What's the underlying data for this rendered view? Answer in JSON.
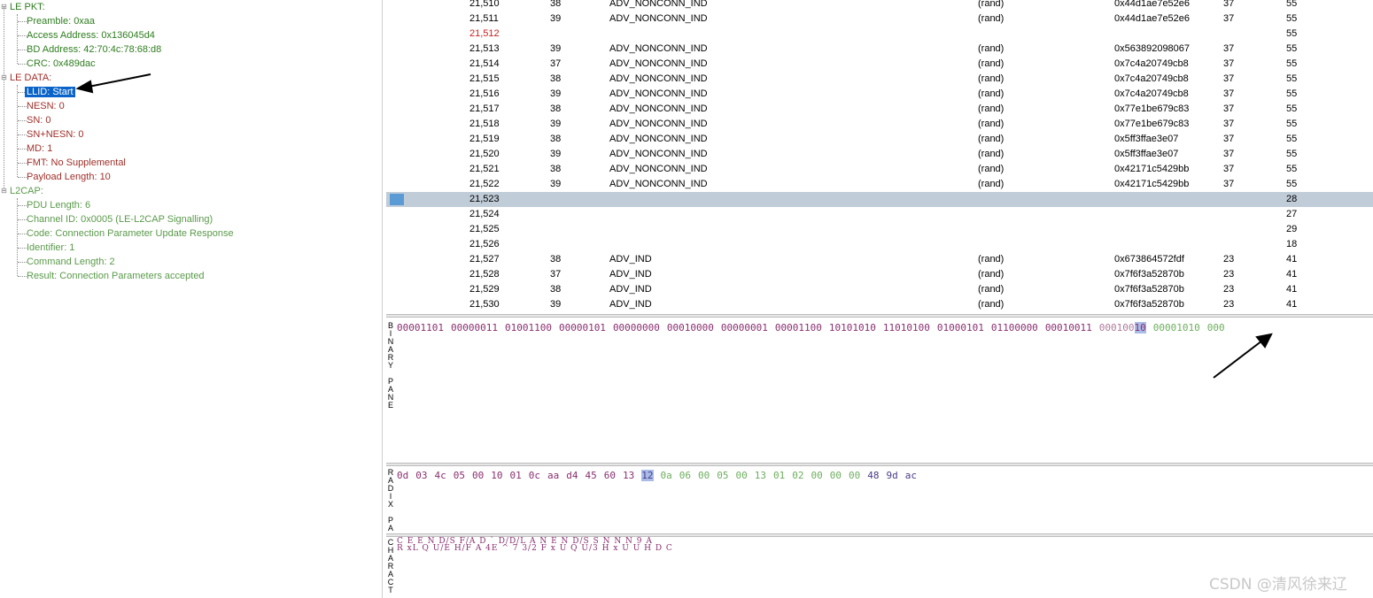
{
  "tree": {
    "le_pkt": {
      "label": "LE PKT:",
      "children": [
        "Preamble: 0xaa",
        "Access Address: 0x136045d4",
        "BD Address: 42:70:4c:78:68:d8",
        "CRC: 0x489dac"
      ]
    },
    "le_data": {
      "label": "LE DATA:",
      "selected": "LLID: Start",
      "children": [
        "NESN: 0",
        "SN: 0",
        "SN+NESN: 0",
        "MD: 1",
        "FMT: No Supplemental",
        "Payload Length: 10"
      ]
    },
    "l2cap": {
      "label": "L2CAP:",
      "children": [
        "PDU Length: 6",
        "Channel ID: 0x0005  (LE-L2CAP Signalling)",
        "Code: Connection Parameter Update Response",
        "Identifier: 1",
        "Command Length: 2",
        "Result: Connection Parameters accepted"
      ]
    },
    "expander_glyph": "⊟"
  },
  "packets": [
    {
      "num": "21,510",
      "ch": "38",
      "type": "ADV_NONCONN_IND",
      "rand": "(rand)",
      "addr": "0x44d1ae7e52e6",
      "len": "37",
      "pl": "55"
    },
    {
      "num": "21,511",
      "ch": "39",
      "type": "ADV_NONCONN_IND",
      "rand": "(rand)",
      "addr": "0x44d1ae7e52e6",
      "len": "37",
      "pl": "55"
    },
    {
      "num": "21,512",
      "ch": "",
      "type": "",
      "rand": "",
      "addr": "",
      "len": "",
      "pl": "55"
    },
    {
      "num": "21,513",
      "ch": "39",
      "type": "ADV_NONCONN_IND",
      "rand": "(rand)",
      "addr": "0x563892098067",
      "len": "37",
      "pl": "55"
    },
    {
      "num": "21,514",
      "ch": "37",
      "type": "ADV_NONCONN_IND",
      "rand": "(rand)",
      "addr": "0x7c4a20749cb8",
      "len": "37",
      "pl": "55"
    },
    {
      "num": "21,515",
      "ch": "38",
      "type": "ADV_NONCONN_IND",
      "rand": "(rand)",
      "addr": "0x7c4a20749cb8",
      "len": "37",
      "pl": "55"
    },
    {
      "num": "21,516",
      "ch": "39",
      "type": "ADV_NONCONN_IND",
      "rand": "(rand)",
      "addr": "0x7c4a20749cb8",
      "len": "37",
      "pl": "55"
    },
    {
      "num": "21,517",
      "ch": "38",
      "type": "ADV_NONCONN_IND",
      "rand": "(rand)",
      "addr": "0x77e1be679c83",
      "len": "37",
      "pl": "55"
    },
    {
      "num": "21,518",
      "ch": "39",
      "type": "ADV_NONCONN_IND",
      "rand": "(rand)",
      "addr": "0x77e1be679c83",
      "len": "37",
      "pl": "55"
    },
    {
      "num": "21,519",
      "ch": "38",
      "type": "ADV_NONCONN_IND",
      "rand": "(rand)",
      "addr": "0x5ff3ffae3e07",
      "len": "37",
      "pl": "55"
    },
    {
      "num": "21,520",
      "ch": "39",
      "type": "ADV_NONCONN_IND",
      "rand": "(rand)",
      "addr": "0x5ff3ffae3e07",
      "len": "37",
      "pl": "55"
    },
    {
      "num": "21,521",
      "ch": "38",
      "type": "ADV_NONCONN_IND",
      "rand": "(rand)",
      "addr": "0x42171c5429bb",
      "len": "37",
      "pl": "55"
    },
    {
      "num": "21,522",
      "ch": "39",
      "type": "ADV_NONCONN_IND",
      "rand": "(rand)",
      "addr": "0x42171c5429bb",
      "len": "37",
      "pl": "55"
    },
    {
      "num": "21,523",
      "ch": "",
      "type": "",
      "rand": "",
      "addr": "",
      "len": "",
      "pl": "28"
    },
    {
      "num": "21,524",
      "ch": "",
      "type": "",
      "rand": "",
      "addr": "",
      "len": "",
      "pl": "27"
    },
    {
      "num": "21,525",
      "ch": "",
      "type": "",
      "rand": "",
      "addr": "",
      "len": "",
      "pl": "29"
    },
    {
      "num": "21,526",
      "ch": "",
      "type": "",
      "rand": "",
      "addr": "",
      "len": "",
      "pl": "18"
    },
    {
      "num": "21,527",
      "ch": "38",
      "type": "ADV_IND",
      "rand": "(rand)",
      "addr": "0x673864572fdf",
      "len": "23",
      "pl": "41"
    },
    {
      "num": "21,528",
      "ch": "37",
      "type": "ADV_IND",
      "rand": "(rand)",
      "addr": "0x7f6f3a52870b",
      "len": "23",
      "pl": "41"
    },
    {
      "num": "21,529",
      "ch": "38",
      "type": "ADV_IND",
      "rand": "(rand)",
      "addr": "0x7f6f3a52870b",
      "len": "23",
      "pl": "41"
    },
    {
      "num": "21,530",
      "ch": "39",
      "type": "ADV_IND",
      "rand": "(rand)",
      "addr": "0x7f6f3a52870b",
      "len": "23",
      "pl": "41"
    }
  ],
  "selected_packet": "21,523",
  "error_packet": "21,512",
  "binary_pane": {
    "label": "BINARY PANE",
    "bytes": [
      "00001101",
      "00000011",
      "01001100",
      "00000101",
      "00000000",
      "00010000",
      "00000001",
      "00001100",
      "10101010",
      "11010100",
      "01000101",
      "01100000",
      "00010011"
    ],
    "highlight_prefix": "000100",
    "highlight_bits": "10",
    "after": [
      "00001010",
      "000"
    ]
  },
  "radix_pane": {
    "label": "RADIX PA",
    "purple": [
      "0d",
      "03",
      "4c",
      "05",
      "00",
      "10",
      "01",
      "0c",
      "aa",
      "d4",
      "45",
      "60",
      "13"
    ],
    "highlight": "12",
    "green": [
      "0a",
      "06",
      "00",
      "05",
      "00",
      "13",
      "01",
      "02",
      "00",
      "00",
      "00"
    ],
    "dark": [
      "48",
      "9d",
      "ac"
    ]
  },
  "character_pane": {
    "label": "CHARACT",
    "row1": "C E  E N D/S F/A D  ` D/D/L A N E N D/S S N N N  9 A",
    "row2": " R xL  Q U/E H/F A 4E  ^ 7 3/2  F x U Q U/3 H x U U H D C"
  },
  "watermark": "CSDN @清风徐来辽",
  "colors": {
    "tree_green": "#2e7d1f",
    "tree_red": "#a0302a",
    "selection": "#0a63c9",
    "row_highlight": "#c0ccd8",
    "error_number": "#c81e1e",
    "binary_purple": "#8a2f70",
    "binary_green": "#6cae5c"
  }
}
